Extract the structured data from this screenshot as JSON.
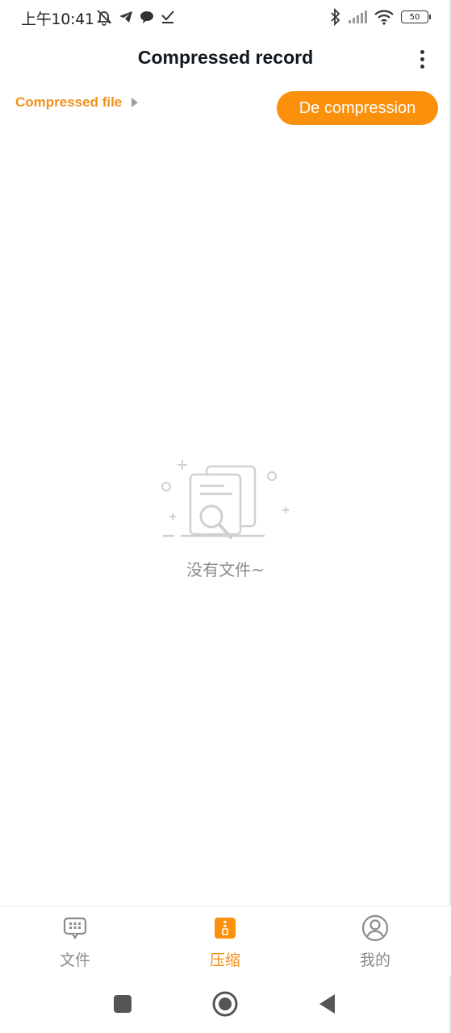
{
  "status_bar": {
    "time": "上午10:41",
    "battery": "50"
  },
  "app_bar": {
    "title": "Compressed record"
  },
  "breadcrumb": {
    "label": "Compressed file"
  },
  "actions": {
    "decompress_label": "De compression"
  },
  "empty_state": {
    "message": "没有文件~"
  },
  "bottom_nav": {
    "items": [
      {
        "label": "文件",
        "icon": "file-grid-icon"
      },
      {
        "label": "压缩",
        "icon": "zip-icon"
      },
      {
        "label": "我的",
        "icon": "profile-icon"
      }
    ],
    "active_index": 1
  },
  "colors": {
    "accent": "#fb900d",
    "accent_text": "#f3901a",
    "muted": "#8a8a8a",
    "title": "#101820"
  }
}
